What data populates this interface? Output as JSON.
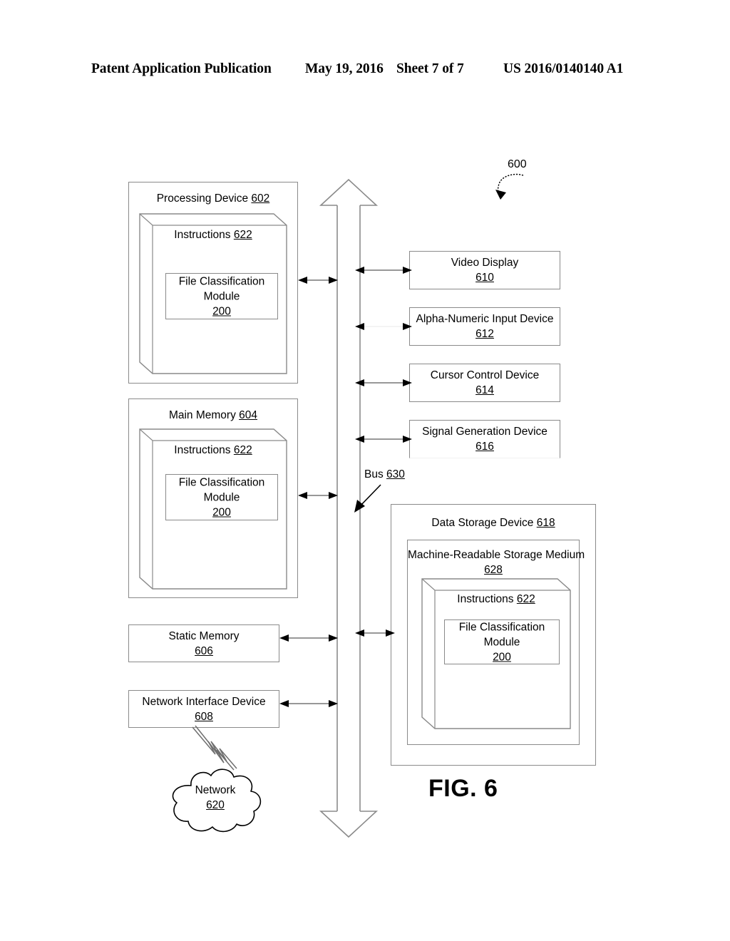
{
  "header": {
    "publication": "Patent Application Publication",
    "date": "May 19, 2016",
    "sheet": "Sheet 7 of 7",
    "document_number": "US 2016/0140140 A1"
  },
  "figure": {
    "caption": "FIG. 6",
    "system_reference": "600"
  },
  "bus": {
    "label": "Bus",
    "reference": "630"
  },
  "blocks": {
    "processing_device": {
      "label": "Processing Device",
      "reference": "602",
      "instructions": {
        "label": "Instructions",
        "reference": "622",
        "module": {
          "label": "File Classification Module",
          "reference": "200"
        }
      }
    },
    "main_memory": {
      "label": "Main Memory",
      "reference": "604",
      "instructions": {
        "label": "Instructions",
        "reference": "622",
        "module": {
          "label": "File Classification Module",
          "reference": "200"
        }
      }
    },
    "static_memory": {
      "label": "Static Memory",
      "reference": "606"
    },
    "network_interface_device": {
      "label": "Network Interface Device",
      "reference": "608"
    },
    "network": {
      "label": "Network",
      "reference": "620"
    },
    "video_display": {
      "label": "Video Display",
      "reference": "610"
    },
    "alpha_numeric_input_device": {
      "label": "Alpha-Numeric Input Device",
      "reference": "612"
    },
    "cursor_control_device": {
      "label": "Cursor Control Device",
      "reference": "614"
    },
    "signal_generation_device": {
      "label": "Signal Generation Device",
      "reference": "616"
    },
    "data_storage_device": {
      "label": "Data Storage Device",
      "reference": "618",
      "storage_medium": {
        "label": "Machine-Readable Storage Medium",
        "reference": "628",
        "instructions": {
          "label": "Instructions",
          "reference": "622",
          "module": {
            "label": "File Classification Module",
            "reference": "200"
          }
        }
      }
    }
  },
  "colors": {
    "line": "#8a8a8a",
    "dark_line": "#000000",
    "background": "#ffffff"
  }
}
